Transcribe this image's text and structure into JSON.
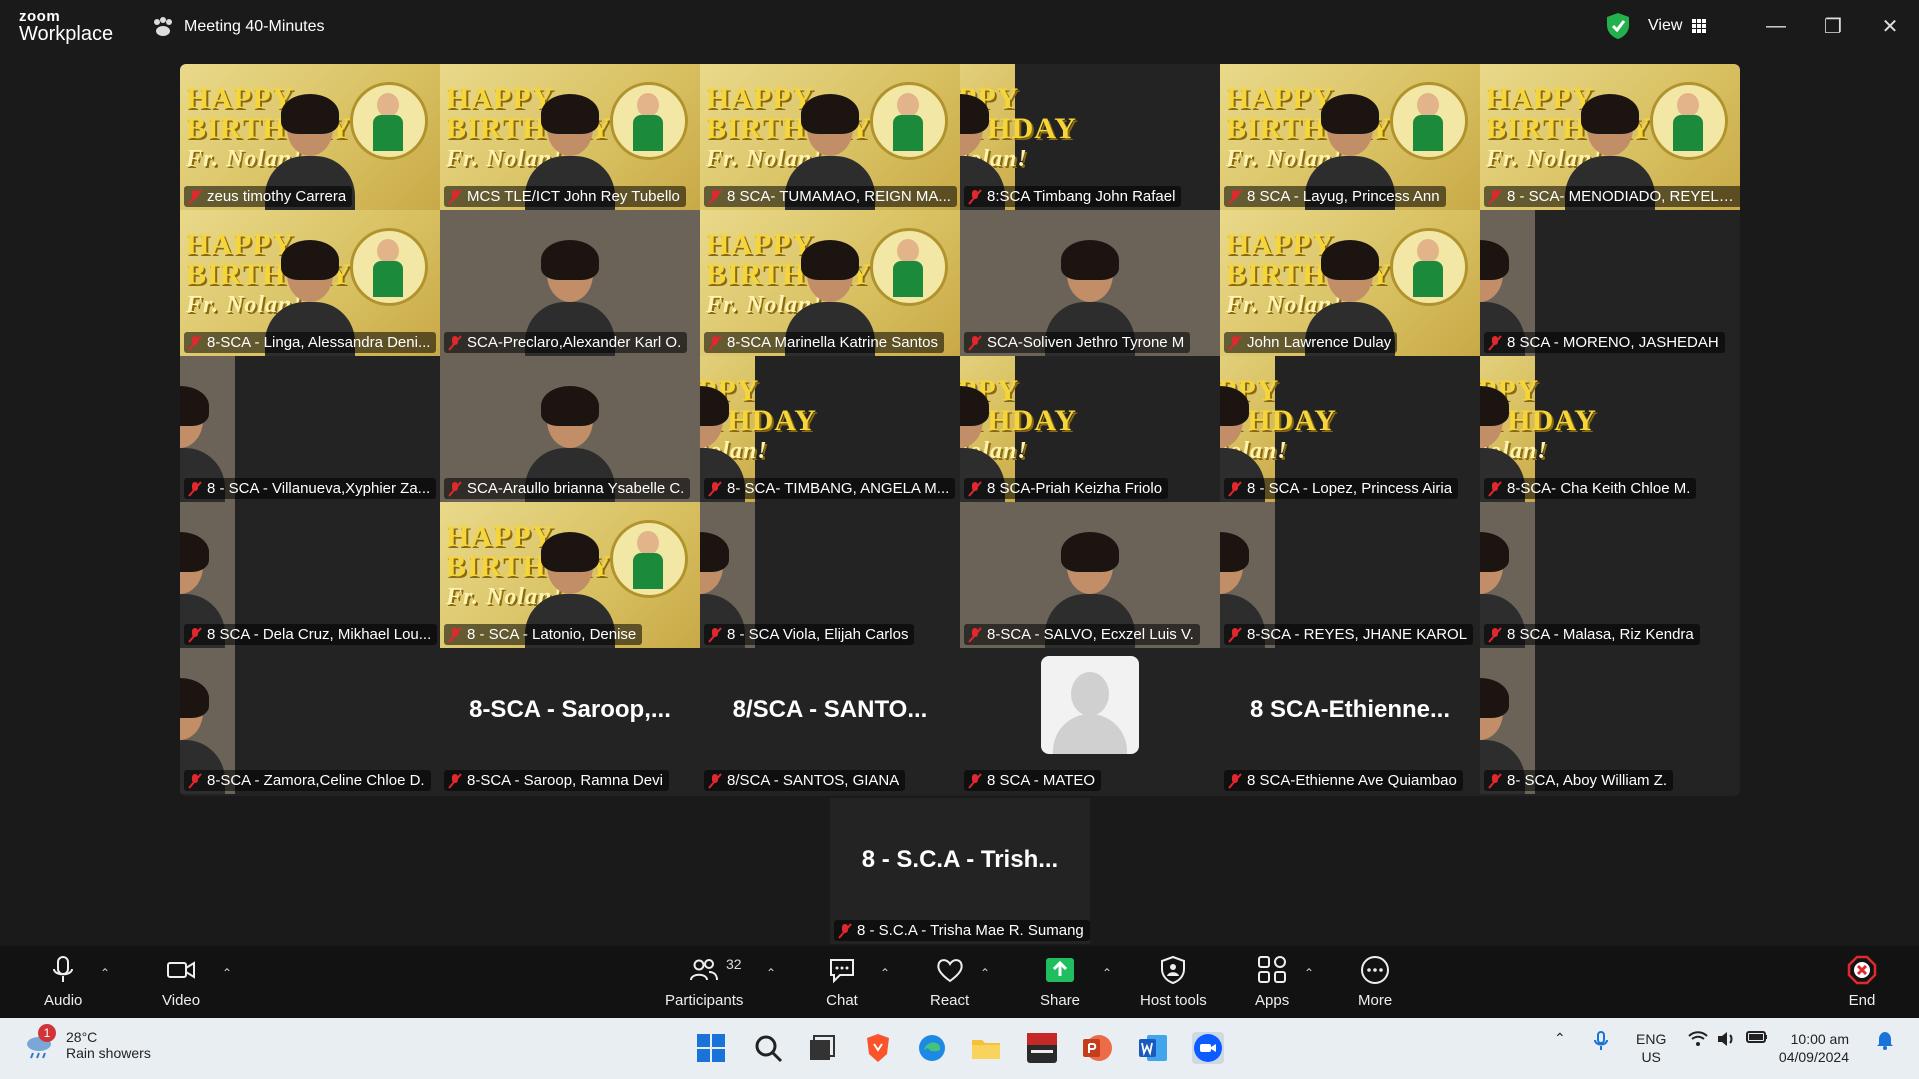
{
  "app": {
    "brand_small": "zoom",
    "brand_large": "Workplace",
    "meeting_title": "Meeting 40-Minutes",
    "view_label": "View"
  },
  "participants": [
    {
      "name": "zeus timothy Carrera",
      "bday": true
    },
    {
      "name": "MCS TLE/ICT John Rey Tubello",
      "bday": true,
      "active": true
    },
    {
      "name": "8 SCA- TUMAMAO, REIGN MA...",
      "bday": true
    },
    {
      "name": "8:SCA Timbang John Rafael",
      "bday": true,
      "narrow": true
    },
    {
      "name": "8 SCA - Layug, Princess Ann",
      "bday": true
    },
    {
      "name": "8 - SCA- MENODIADO, REYELL ...",
      "bday": true
    },
    {
      "name": "8-SCA - Linga, Alessandra Deni...",
      "bday": true
    },
    {
      "name": "SCA-Preclaro,Alexander Karl O.",
      "bday": false
    },
    {
      "name": "8-SCA Marinella Katrine Santos",
      "bday": true
    },
    {
      "name": "SCA-Soliven Jethro Tyrone M",
      "bday": false
    },
    {
      "name": "John Lawrence Dulay",
      "bday": true
    },
    {
      "name": "8 SCA - MORENO, JASHEDAH",
      "bday": false,
      "narrow": true
    },
    {
      "name": "8 - SCA - Villanueva,Xyphier Za...",
      "bday": false,
      "narrow": true
    },
    {
      "name": "SCA-Araullo brianna Ysabelle C.",
      "bday": false
    },
    {
      "name": "8- SCA- TIMBANG, ANGELA M...",
      "bday": true,
      "narrow": true
    },
    {
      "name": "8 SCA-Priah Keizha Friolo",
      "bday": true,
      "narrow": true
    },
    {
      "name": "8 - SCA - Lopez, Princess Airia",
      "bday": true,
      "narrow": true
    },
    {
      "name": "8-SCA- Cha Keith Chloe M.",
      "bday": true,
      "narrow": true
    },
    {
      "name": "8 SCA - Dela Cruz, Mikhael Lou...",
      "bday": false,
      "narrow": true
    },
    {
      "name": "8 - SCA - Latonio, Denise",
      "bday": true
    },
    {
      "name": "8 - SCA Viola, Elijah Carlos",
      "bday": false,
      "narrow": true
    },
    {
      "name": "8-SCA - SALVO, Ecxzel Luis V.",
      "bday": false
    },
    {
      "name": "8-SCA - REYES, JHANE KAROL",
      "bday": false,
      "narrow": true
    },
    {
      "name": "8 SCA - Malasa, Riz Kendra",
      "bday": false,
      "narrow": true
    },
    {
      "name": "8-SCA - Zamora,Celine Chloe D.",
      "bday": false,
      "narrow": true
    },
    {
      "name": "8-SCA - Saroop, Ramna Devi",
      "big": "8-SCA - Saroop,..."
    },
    {
      "name": "8/SCA - SANTOS, GIANA",
      "big": "8/SCA - SANTO..."
    },
    {
      "name": "8 SCA - MATEO",
      "avatar": true
    },
    {
      "name": "8 SCA-Ethienne Ave Quiambao",
      "big": "8 SCA-Ethienne..."
    },
    {
      "name": "8- SCA, Aboy William Z.",
      "bday": false,
      "narrow": true
    }
  ],
  "last_tile": {
    "name": "8 - S.C.A - Trisha Mae R. Sumang",
    "big": "8 - S.C.A - Trish..."
  },
  "bday_text": {
    "line1": "HAPPY",
    "line2": "BIRTHDAY",
    "line3": "Fr. Nolan!"
  },
  "toolbar": {
    "audio": "Audio",
    "video": "Video",
    "participants": "Participants",
    "participant_count": "32",
    "chat": "Chat",
    "react": "React",
    "share": "Share",
    "host_tools": "Host tools",
    "apps": "Apps",
    "more": "More",
    "end": "End"
  },
  "taskbar": {
    "temp": "28°C",
    "weather": "Rain showers",
    "badge": "1",
    "lang1": "ENG",
    "lang2": "US",
    "time": "10:00 am",
    "date": "04/09/2024"
  },
  "colors": {
    "accent_green": "#2ecc71",
    "end_red": "#e0282e",
    "share_green": "#1fbf5f"
  }
}
